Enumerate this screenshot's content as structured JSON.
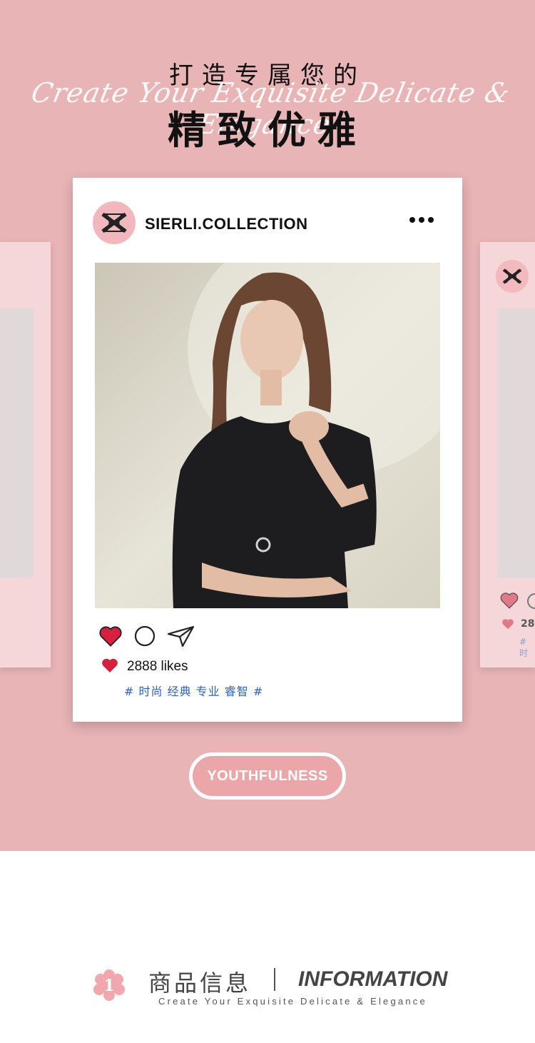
{
  "hero": {
    "title_cn_top": "打造专属您的",
    "title_script": "Create Your Exquisite Delicate & Elegance",
    "title_cn_main": "精致优雅"
  },
  "post": {
    "account_name": "SIERLI.COLLECTION",
    "likes": "2888 likes",
    "hashtags": "# 时尚 经典 专业 睿智 #"
  },
  "side_card_right": {
    "likes_partial": "28",
    "tag_partial": "# 时"
  },
  "cta": {
    "label": "YOUTHFULNESS"
  },
  "section_header": {
    "badge_number": "1",
    "title_cn": "商品信息",
    "title_en": "INFORMATION",
    "subtitle": "Create Your Exquisite Delicate & Elegance"
  },
  "icons": {
    "like": "heart-icon",
    "comment": "comment-icon",
    "share": "share-icon",
    "more": "more-icon",
    "logo": "brand-logo-icon",
    "badge": "flower-badge-icon"
  },
  "colors": {
    "background_pink": "#e8b4b6",
    "heart_red": "#d3213f",
    "hashtag_blue": "#2f63b8",
    "pill_fill": "#eba6a9"
  }
}
